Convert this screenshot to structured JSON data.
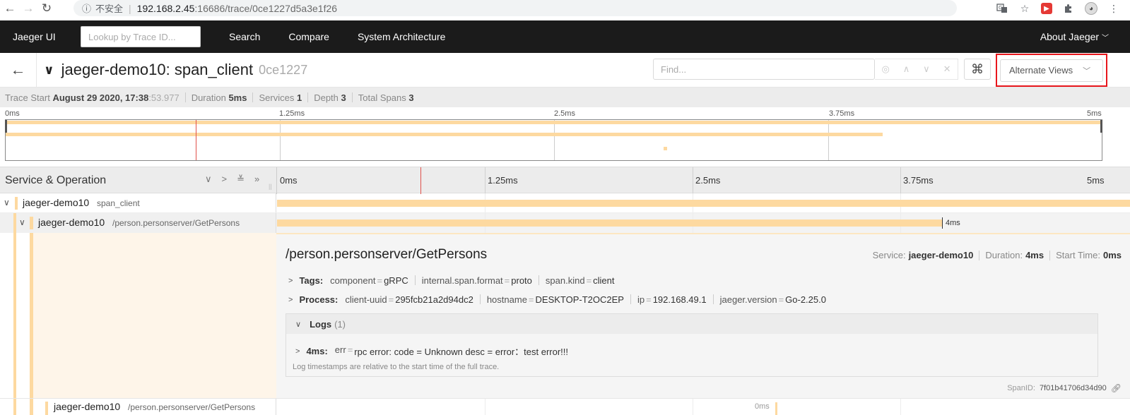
{
  "browser": {
    "back": "←",
    "forward": "→",
    "reload": "↻",
    "info_icon": "ⓘ",
    "security": "不安全",
    "url_host": "192.168.2.45",
    "url_rest": ":16686/trace/0ce1227d5a3e1f26"
  },
  "topnav": {
    "brand": "Jaeger UI",
    "lookup_placeholder": "Lookup by Trace ID...",
    "links": [
      "Search",
      "Compare",
      "System Architecture"
    ],
    "about": "About Jaeger"
  },
  "trace": {
    "title": "jaeger-demo10: span_client",
    "id_short": "0ce1227",
    "find_placeholder": "Find...",
    "alt_views": "Alternate Views"
  },
  "meta": {
    "trace_start_label": "Trace Start",
    "trace_start_value": "August 29 2020, 17:38",
    "trace_start_ms": ":53.977",
    "duration_label": "Duration",
    "duration_value": "5ms",
    "services_label": "Services",
    "services_value": "1",
    "depth_label": "Depth",
    "depth_value": "3",
    "total_spans_label": "Total Spans",
    "total_spans_value": "3"
  },
  "ticks": [
    "0ms",
    "1.25ms",
    "2.5ms",
    "3.75ms",
    "5ms"
  ],
  "timeline": {
    "header_title": "Service & Operation"
  },
  "spans": [
    {
      "service": "jaeger-demo10",
      "operation": "span_client"
    },
    {
      "service": "jaeger-demo10",
      "operation": "/person.personserver/GetPersons",
      "duration_label": "4ms"
    },
    {
      "service": "jaeger-demo10",
      "operation": "/person.personserver/GetPersons",
      "duration_label": "0ms"
    }
  ],
  "detail": {
    "title": "/person.personserver/GetPersons",
    "service_label": "Service:",
    "service_value": "jaeger-demo10",
    "duration_label": "Duration:",
    "duration_value": "4ms",
    "start_label": "Start Time:",
    "start_value": "0ms",
    "tags_label": "Tags:",
    "tags": [
      {
        "k": "component",
        "v": "gRPC"
      },
      {
        "k": "internal.span.format",
        "v": "proto"
      },
      {
        "k": "span.kind",
        "v": "client"
      }
    ],
    "process_label": "Process:",
    "process": [
      {
        "k": "client-uuid",
        "v": "295fcb21a2d94dc2"
      },
      {
        "k": "hostname",
        "v": "DESKTOP-T2OC2EP"
      },
      {
        "k": "ip",
        "v": "192.168.49.1"
      },
      {
        "k": "jaeger.version",
        "v": "Go-2.25.0"
      }
    ],
    "logs_label": "Logs",
    "logs_count": "(1)",
    "log_time": "4ms:",
    "log_key": "err",
    "log_value": "rpc error: code = Unknown desc = error：test error!!!",
    "log_note": "Log timestamps are relative to the start time of the full trace.",
    "span_id_label": "SpanID:",
    "span_id_value": "7f01b41706d34d90"
  },
  "colors": {
    "span_bar": "#fdd9a0",
    "nav_bg": "#1b1b1b",
    "highlight_border": "#e8161c",
    "cursor": "#e0514b"
  },
  "icons": {
    "translate": "translate-icon",
    "star": "star-icon",
    "extension": "extension-icon",
    "profile": "avatar-icon",
    "menu": "more-vert-icon"
  }
}
